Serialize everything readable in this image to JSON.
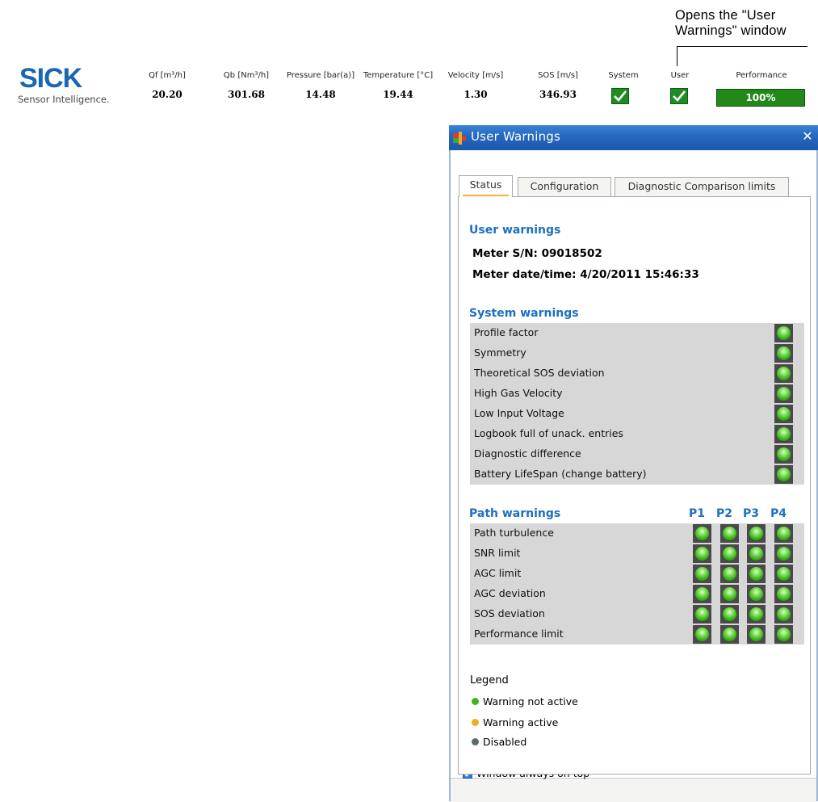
{
  "callout": {
    "text": "Opens the \"User Warnings\" window"
  },
  "topbar": {
    "logo": {
      "brand": "SICK",
      "tagline": "Sensor Intelligence."
    },
    "measurements": [
      {
        "label": "Qf [m³/h]",
        "value": "20.20"
      },
      {
        "label": "Qb [Nm³/h]",
        "value": "301.68"
      },
      {
        "label": "Pressure [bar(a)]",
        "value": "14.48"
      },
      {
        "label": "Temperature [°C]",
        "value": "19.44"
      },
      {
        "label": "Velocity [m/s]",
        "value": "1.30"
      },
      {
        "label": "SOS [m/s]",
        "value": "346.93"
      }
    ],
    "system": {
      "label": "System",
      "state": "ok"
    },
    "user": {
      "label": "User",
      "state": "ok"
    },
    "performance": {
      "label": "Performance",
      "value": "100%",
      "fraction": 1.0
    },
    "colors": {
      "brand": "#1a66b0",
      "ok": "#1e8c23"
    }
  },
  "window": {
    "title": "User Warnings",
    "close_icon": "close-icon",
    "tabs": [
      {
        "label": "Status",
        "active": true
      },
      {
        "label": "Configuration",
        "active": false
      },
      {
        "label": "Diagnostic Comparison limits",
        "active": false
      }
    ],
    "user_warnings": {
      "title": "User warnings",
      "meter_sn": "Meter S/N: 09018502",
      "meter_datetime": "Meter date/time: 4/20/2011 15:46:33"
    },
    "system_warnings": {
      "title": "System warnings",
      "items": [
        {
          "label": "Profile factor",
          "state": "not-active"
        },
        {
          "label": "Symmetry",
          "state": "not-active"
        },
        {
          "label": "Theoretical SOS deviation",
          "state": "not-active"
        },
        {
          "label": "High Gas Velocity",
          "state": "not-active"
        },
        {
          "label": "Low Input Voltage",
          "state": "not-active"
        },
        {
          "label": "Logbook full of unack. entries",
          "state": "not-active"
        },
        {
          "label": "Diagnostic difference",
          "state": "not-active"
        },
        {
          "label": "Battery LifeSpan (change battery)",
          "state": "not-active"
        }
      ]
    },
    "path_warnings": {
      "title": "Path warnings",
      "paths": [
        "P1",
        "P2",
        "P3",
        "P4"
      ],
      "items": [
        {
          "label": "Path turbulence",
          "states": [
            "not-active",
            "not-active",
            "not-active",
            "not-active"
          ]
        },
        {
          "label": "SNR limit",
          "states": [
            "not-active",
            "not-active",
            "not-active",
            "not-active"
          ]
        },
        {
          "label": "AGC limit",
          "states": [
            "not-active",
            "not-active",
            "not-active",
            "not-active"
          ]
        },
        {
          "label": "AGC deviation",
          "states": [
            "not-active",
            "not-active",
            "not-active",
            "not-active"
          ]
        },
        {
          "label": "SOS deviation",
          "states": [
            "not-active",
            "not-active",
            "not-active",
            "not-active"
          ]
        },
        {
          "label": "Performance limit",
          "states": [
            "not-active",
            "not-active",
            "not-active",
            "not-active"
          ]
        }
      ]
    },
    "legend": {
      "title": "Legend",
      "items": [
        {
          "label": "Warning not active",
          "color": "#3cb61a"
        },
        {
          "label": "Warning active",
          "color": "#e8b21c"
        },
        {
          "label": "Disabled",
          "color": "#5a6a70"
        }
      ]
    },
    "always_on_top": {
      "label": "Window always on top",
      "checked": true
    }
  }
}
